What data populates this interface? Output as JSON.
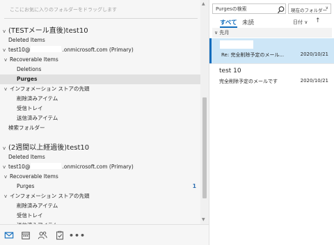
{
  "folder_pane": {
    "favorites_hint": "ここにお気に入りのフォルダーをドラッグします",
    "tree": [
      {
        "label": "(TESTメール直後)test10",
        "type": "account",
        "chev": "v"
      },
      {
        "label": "Deleted Items",
        "type": "folder",
        "chev": ""
      },
      {
        "label": "test10@",
        "suffix": ".onmicrosoft.com (Primary)",
        "type": "mailbox",
        "chev": "v"
      },
      {
        "label": "Recoverable Items",
        "type": "folder",
        "chev": "v"
      },
      {
        "label": "Deletions",
        "type": "folder",
        "chev": ""
      },
      {
        "label": "Purges",
        "type": "folder",
        "chev": "",
        "selected": true
      },
      {
        "label": "インフォメーション ストアの先頭",
        "type": "folder",
        "chev": "v"
      },
      {
        "label": "削除済みアイテム",
        "type": "folder",
        "chev": ""
      },
      {
        "label": "受信トレイ",
        "type": "folder",
        "chev": ""
      },
      {
        "label": "送信済みアイテム",
        "type": "folder",
        "chev": ""
      },
      {
        "label": "検索フォルダー",
        "type": "folder",
        "chev": ""
      },
      {
        "label": "(2週間以上経過後)test10",
        "type": "account",
        "chev": "v"
      },
      {
        "label": "Deleted Items",
        "type": "folder",
        "chev": ""
      },
      {
        "label": "test10@",
        "suffix": ".onmicrosoft.com (Primary)",
        "type": "mailbox",
        "chev": "v"
      },
      {
        "label": "Recoverable Items",
        "type": "folder",
        "chev": "v"
      },
      {
        "label": "Purges",
        "type": "folder",
        "chev": "",
        "count": "1"
      },
      {
        "label": "インフォメーション ストアの先頭",
        "type": "folder",
        "chev": "v"
      },
      {
        "label": "削除済みアイテム",
        "type": "folder",
        "chev": ""
      },
      {
        "label": "受信トレイ",
        "type": "folder",
        "chev": ""
      },
      {
        "label": "送信済みアイテム",
        "type": "folder",
        "chev": ""
      }
    ]
  },
  "bottom_nav": {
    "icons": [
      "mail-icon",
      "calendar-icon",
      "people-icon",
      "tasks-icon"
    ],
    "more_label": "•••"
  },
  "message_list": {
    "search_placeholder": "Purgesの検索",
    "scope_label": "現在のフォルダー",
    "tab_all": "すべて",
    "tab_unread": "未読",
    "sort_label": "日付 ∨",
    "sort_arrow": "↑",
    "group_header": "先月",
    "messages": [
      {
        "sender": "",
        "subject": "Re: 完全削除予定のメール...",
        "date": "2020/10/21",
        "selected": true
      },
      {
        "sender": "test 10",
        "subject": "完全削除予定のメールです",
        "date": "2020/10/21",
        "selected": false
      }
    ]
  },
  "colors": {
    "accent": "#0f6cbd",
    "selected_message_bg": "#cde6f7",
    "folder_pane_bg": "#f6f6f6"
  }
}
